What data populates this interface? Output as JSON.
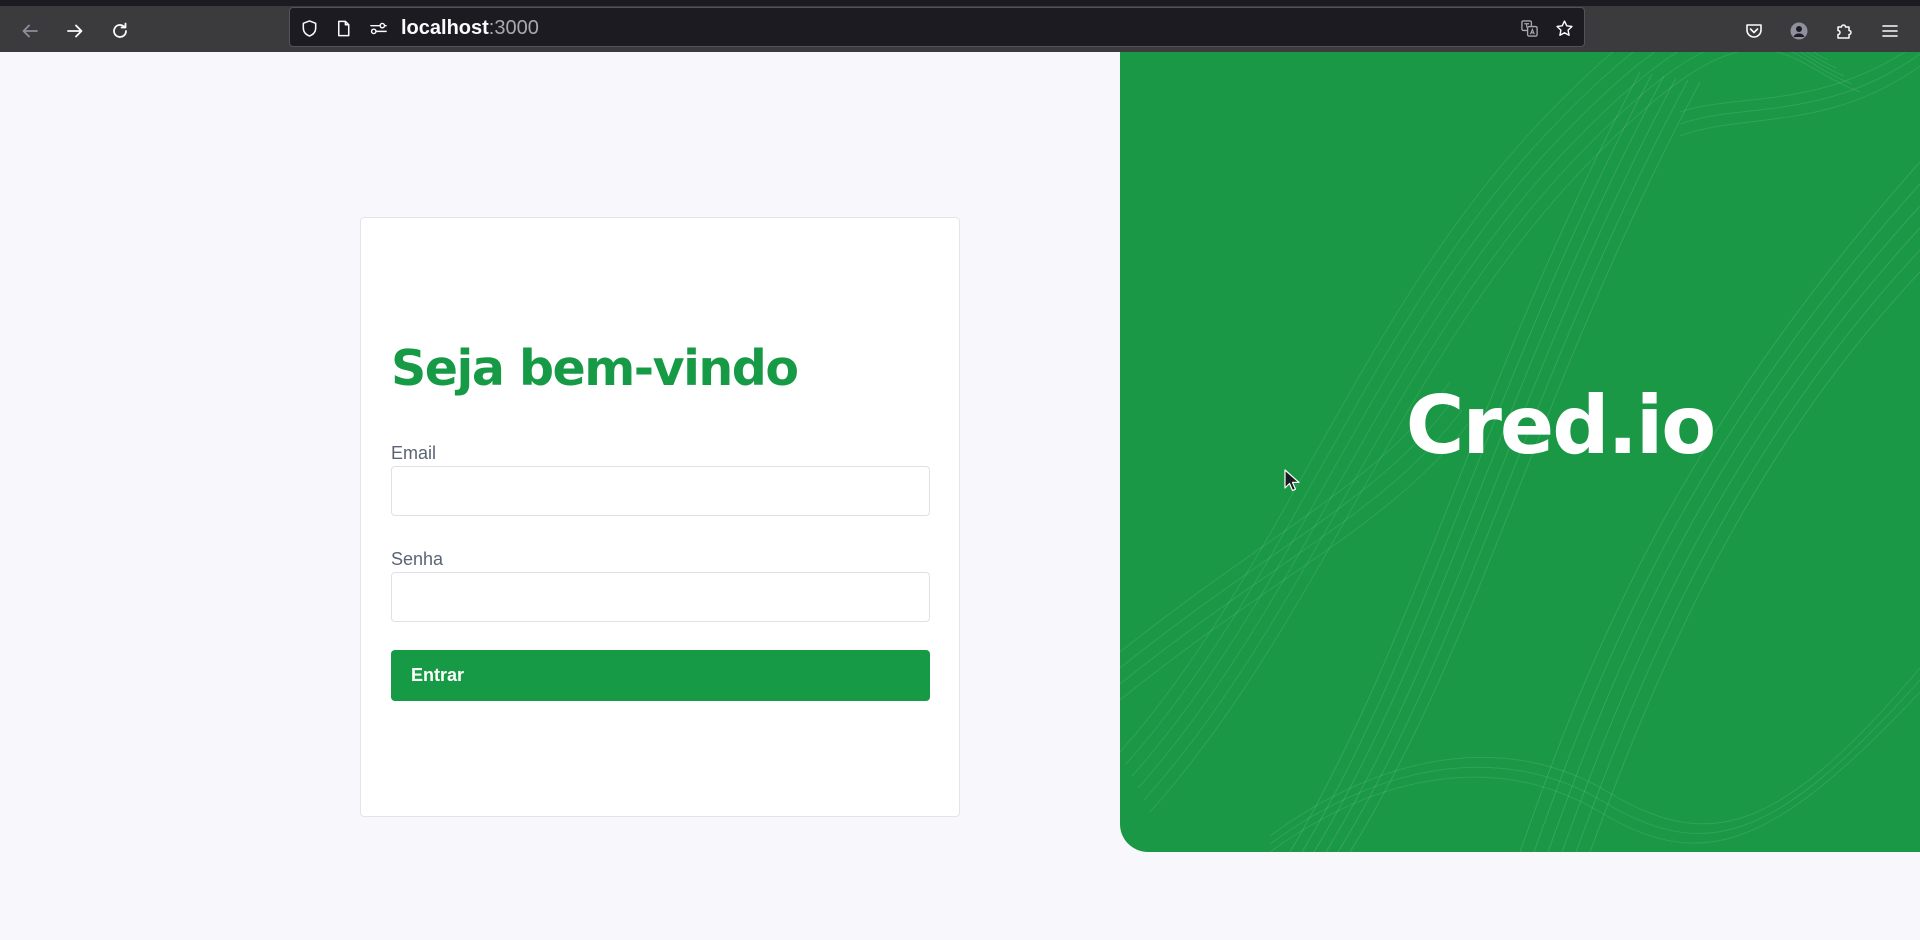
{
  "browser": {
    "url_host": "localhost",
    "url_port": ":3000",
    "icons": {
      "back": "arrow-left-icon",
      "forward": "arrow-right-icon",
      "reload": "reload-icon",
      "shield": "shield-icon",
      "page": "page-icon",
      "permissions": "permissions-icon",
      "translate": "translate-icon",
      "bookmark": "star-icon",
      "pocket": "pocket-icon",
      "account": "account-icon",
      "extensions": "puzzle-icon",
      "menu": "hamburger-menu-icon"
    }
  },
  "login": {
    "title": "Seja bem-vindo",
    "email_label": "Email",
    "email_value": "",
    "password_label": "Senha",
    "password_value": "",
    "submit_label": "Entrar"
  },
  "brand": {
    "name": "Cred.io"
  },
  "colors": {
    "accent": "#179a45",
    "panel": "#1a9845",
    "page_background": "#f8f8fc",
    "browser_toolbar": "#3b3b3e"
  }
}
